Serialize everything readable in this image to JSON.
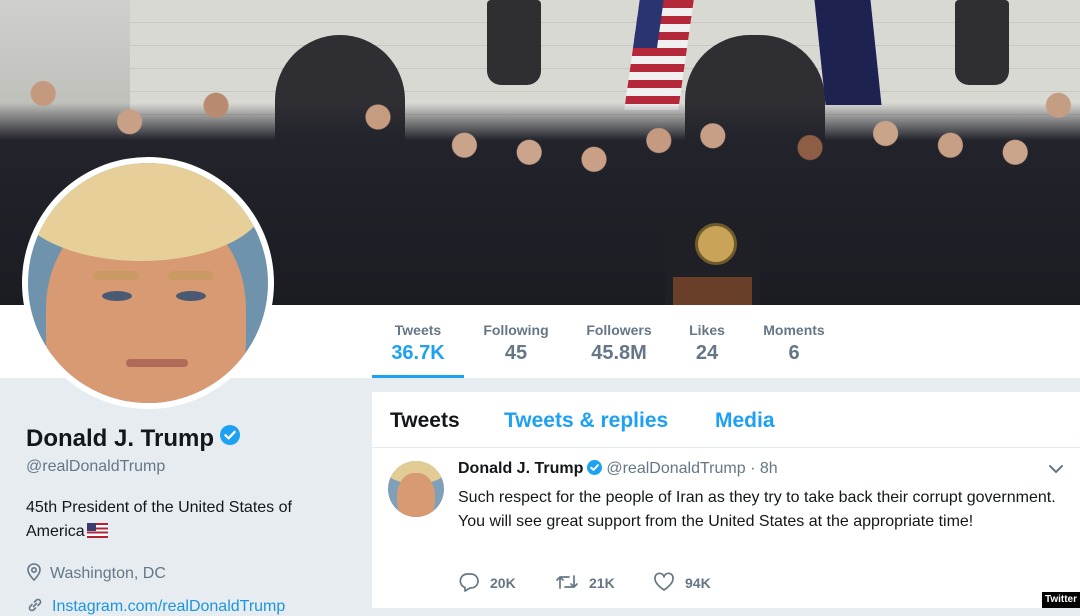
{
  "profile": {
    "name": "Donald J. Trump",
    "handle": "@realDonaldTrump",
    "bio": "45th President of the United States of America",
    "location": "Washington, DC",
    "link": "Instagram.com/realDonaldTrump"
  },
  "stats": [
    {
      "label": "Tweets",
      "value": "36.7K"
    },
    {
      "label": "Following",
      "value": "45"
    },
    {
      "label": "Followers",
      "value": "45.8M"
    },
    {
      "label": "Likes",
      "value": "24"
    },
    {
      "label": "Moments",
      "value": "6"
    }
  ],
  "timeline": {
    "tabs": [
      "Tweets",
      "Tweets & replies",
      "Media"
    ],
    "tweet": {
      "name": "Donald J. Trump",
      "handle": "@realDonaldTrump",
      "separator": "·",
      "time": "8h",
      "text": "Such respect for the people of Iran as they try to take back their corrupt government. You will see great support from the United States at the appropriate time!",
      "replies": "20K",
      "retweets": "21K",
      "likes": "94K"
    }
  },
  "credit": "Twitter",
  "colors": {
    "accent": "#1da1f2",
    "muted": "#657786",
    "background": "#e6ecf0"
  },
  "icons": [
    "verified-badge-icon",
    "location-pin-icon",
    "link-icon",
    "chevron-down-icon",
    "reply-icon",
    "retweet-icon",
    "like-heart-icon",
    "us-flag-icon"
  ]
}
